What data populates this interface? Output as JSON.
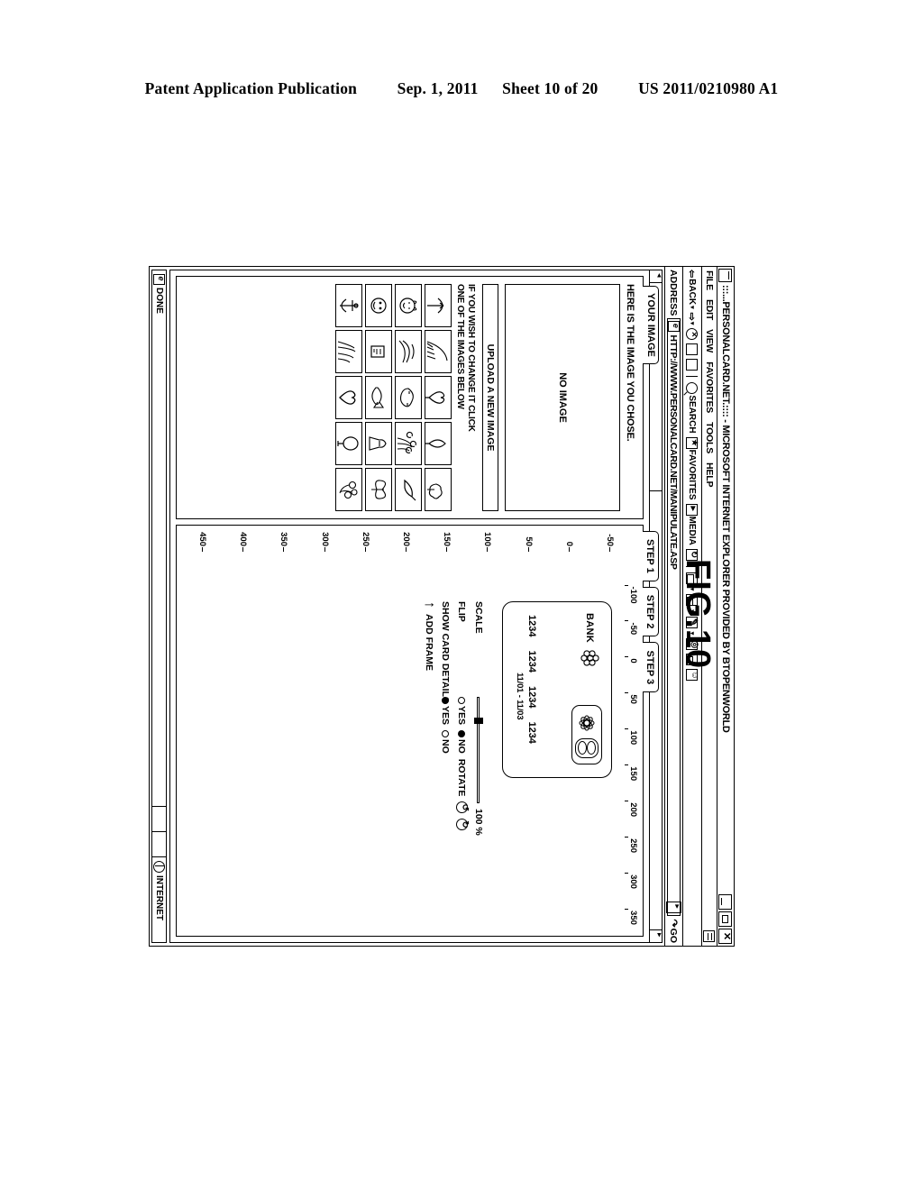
{
  "patent_header": {
    "publication": "Patent Application Publication",
    "date": "Sep. 1, 2011",
    "sheet": "Sheet 10 of 20",
    "number": "US 2011/0210980 A1"
  },
  "figure_label": "FIG.10",
  "window": {
    "title": ":::...PERSONALCARD.NET.:::: - MICROSOFT INTERNET EXPLORER PROVIDED BY BTOPENWORLD",
    "buttons": {
      "minimize": "_",
      "maximize": "□",
      "close": "✕"
    }
  },
  "menu": {
    "items": [
      "FILE",
      "EDIT",
      "VIEW",
      "FAVORITES",
      "TOOLS",
      "HELP"
    ]
  },
  "toolbar": {
    "back": "BACK",
    "stop_icon": "stop-icon",
    "refresh_icon": "refresh-icon",
    "home_icon": "home-icon",
    "search": "SEARCH",
    "favorites": "FAVORITES",
    "media": "MEDIA",
    "history_icon": "history-icon",
    "mail_icon": "mail-icon",
    "print_icon": "print-icon",
    "edit_icon": "edit-icon",
    "discuss_icon": "discuss-icon",
    "messenger_icon": "messenger-icon"
  },
  "address_bar": {
    "label": "ADDRESS",
    "value": "HTTP://WWW.PERSONALCARD.NET/MANIPULATE.ASP",
    "go_label": "GO"
  },
  "left_panel": {
    "tab_label": "YOUR IMAGE",
    "heading": "HERE IS THE IMAGE YOU CHOSE.",
    "image_placeholder": "NO IMAGE",
    "upload_button": "UPLOAD A NEW IMAGE",
    "note_line1": "IF YOU WISH TO CHANGE IT CLICK",
    "note_line2": "ONE OF THE IMAGES BELOW",
    "thumbnails": [
      "thumb-face-1",
      "thumb-bird",
      "thumb-flower-1",
      "thumb-leaf",
      "thumb-scroll",
      "thumb-rabbit",
      "thumb-wave",
      "thumb-mask",
      "thumb-bouquet",
      "thumb-bird-2",
      "thumb-clown",
      "thumb-card",
      "thumb-fish",
      "thumb-lady",
      "thumb-butterfly",
      "thumb-anchor",
      "thumb-grass",
      "thumb-heart",
      "thumb-balloon",
      "thumb-flowers-2"
    ]
  },
  "steps": {
    "tabs": [
      "STEP 1",
      "STEP 2",
      "STEP 3"
    ]
  },
  "rulers": {
    "horizontal": [
      "-100",
      "-50",
      "0",
      "50",
      "100",
      "150",
      "200",
      "250",
      "300",
      "350"
    ],
    "vertical": [
      "-50",
      "0",
      "50",
      "100",
      "150",
      "200",
      "250",
      "300",
      "350",
      "400",
      "450"
    ]
  },
  "card": {
    "bank_label": "BANK",
    "logo_icon": "rosette-logo-icon",
    "chip_icon": "chip-hologram-icon",
    "number_groups": [
      "1234",
      "1234",
      "1234"
    ],
    "corner_number": "1234",
    "valid_dates": "11/01 - 11/03"
  },
  "controls": {
    "scale": {
      "label": "SCALE",
      "value": "100 %",
      "position_pct": 20
    },
    "flip": {
      "label": "FLIP",
      "yes": "YES",
      "no": "NO",
      "selected": "NO"
    },
    "rotate": {
      "label": "ROTATE",
      "ccw_icon": "rotate-ccw-icon",
      "cw_icon": "rotate-cw-icon"
    },
    "show_card_details": {
      "label": "SHOW CARD DETAILS",
      "yes": "YES",
      "no": "NO",
      "selected": "YES"
    },
    "add_frame": {
      "label": "ADD FRAME",
      "arrow_icon": "up-arrow-icon"
    }
  },
  "status_bar": {
    "left": "DONE",
    "zone": "INTERNET",
    "zone_icon": "globe-icon"
  }
}
